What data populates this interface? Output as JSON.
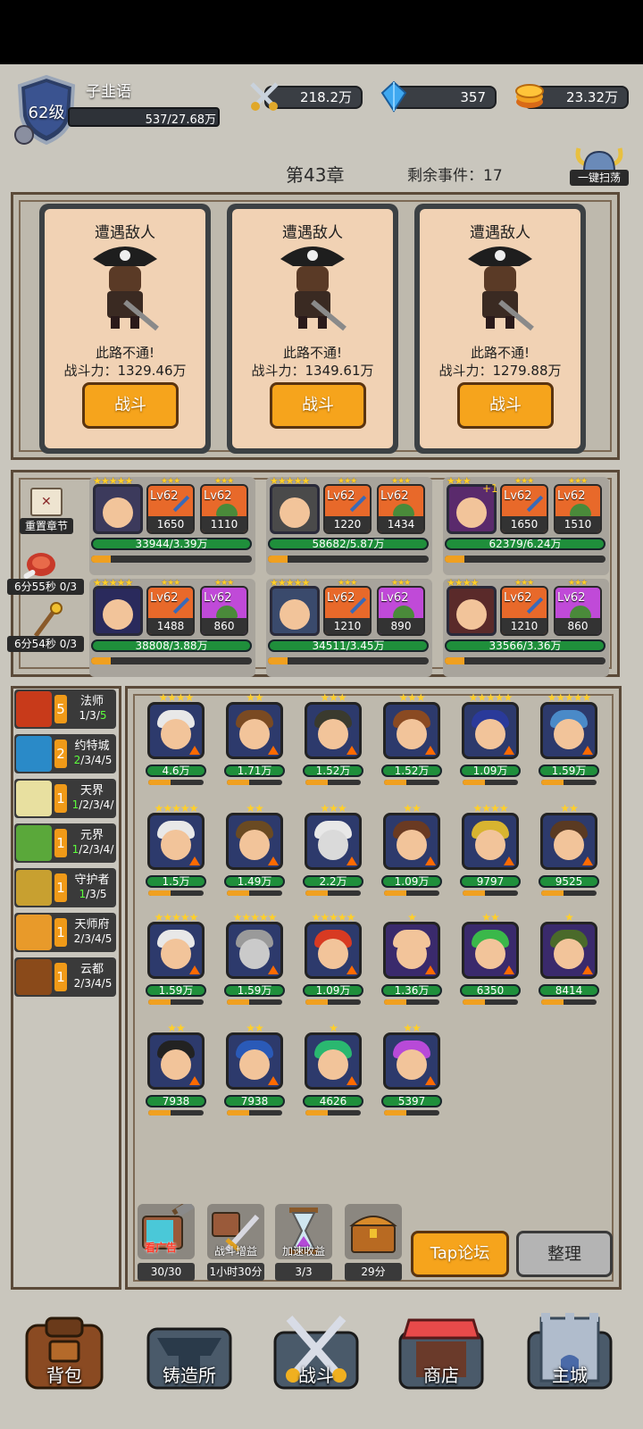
{
  "player": {
    "level": "62级",
    "name": "子韭语",
    "exp": "537/27.68万",
    "exp_fraction": 0.0019
  },
  "resources": {
    "power": "218.2万",
    "gems": "357",
    "gold": "23.32万"
  },
  "chapter": {
    "title": "第43章",
    "remaining_events": "剩余事件：17",
    "sweep_label": "一键扫荡"
  },
  "enemies": [
    {
      "title": "遭遇敌人",
      "desc": "此路不通!",
      "power": "战斗力：1329.46万",
      "button": "战斗"
    },
    {
      "title": "遭遇敌人",
      "desc": "此路不通!",
      "power": "战斗力：1349.61万",
      "button": "战斗"
    },
    {
      "title": "遭遇敌人",
      "desc": "此路不通!",
      "power": "战斗力：1279.88万",
      "button": "战斗"
    }
  ],
  "side_tools": {
    "reset_chapter": "重置章节",
    "timer1": "6分55秒 0/3",
    "timer2": "6分54秒 0/3"
  },
  "team": [
    {
      "stars": "★★★★★",
      "weapon_lv": "Lv62",
      "weapon_val": "1650",
      "armor_lv": "Lv62",
      "armor_val": "1110",
      "hp": "33944/3.39万"
    },
    {
      "stars": "★★★★★",
      "weapon_lv": "Lv62",
      "weapon_val": "1220",
      "armor_lv": "Lv62",
      "armor_val": "1434",
      "hp": "58682/5.87万"
    },
    {
      "stars": "★★★",
      "plus": "+1",
      "weapon_lv": "Lv62",
      "weapon_val": "1650",
      "armor_lv": "Lv62",
      "armor_val": "1510",
      "hp": "62379/6.24万"
    },
    {
      "stars": "★★★★★",
      "weapon_lv": "Lv62",
      "weapon_val": "1488",
      "armor_lv": "Lv62",
      "armor_val": "860",
      "hp": "38808/3.88万"
    },
    {
      "stars": "★★★★★",
      "weapon_lv": "Lv62",
      "weapon_val": "1210",
      "armor_lv": "Lv62",
      "armor_val": "890",
      "hp": "34511/3.45万"
    },
    {
      "stars": "★★★★",
      "weapon_lv": "Lv62",
      "weapon_val": "1210",
      "armor_lv": "Lv62",
      "armor_val": "860",
      "hp": "33566/3.36万"
    }
  ],
  "factions": [
    {
      "count": "5",
      "name": "法师",
      "tiers_a": "1/3/",
      "tiers_b": "5",
      "tiers_c": ""
    },
    {
      "count": "2",
      "name": "约特城",
      "tiers_a": "",
      "tiers_b": "2",
      "tiers_c": "/3/4/5"
    },
    {
      "count": "1",
      "name": "天界",
      "tiers_a": "",
      "tiers_b": "1",
      "tiers_c": "/2/3/4/"
    },
    {
      "count": "1",
      "name": "元界",
      "tiers_a": "",
      "tiers_b": "1",
      "tiers_c": "/2/3/4/"
    },
    {
      "count": "1",
      "name": "守护者",
      "tiers_a": "",
      "tiers_b": "1",
      "tiers_c": "/3/5"
    },
    {
      "count": "1",
      "name": "天师府",
      "tiers_a": "2/3/4/5",
      "tiers_b": "",
      "tiers_c": ""
    },
    {
      "count": "1",
      "name": "云都",
      "tiers_a": "2/3/4/5",
      "tiers_b": "",
      "tiers_c": ""
    }
  ],
  "roster": [
    {
      "stars": "★★★★",
      "power": "4.6万",
      "skin": "#f2c49a",
      "hair": "#e8e8e8",
      "bg": "#2d3a6c"
    },
    {
      "stars": "★★",
      "power": "1.71万",
      "skin": "#f2c49a",
      "hair": "#7a4a22",
      "bg": "#2d3a6c"
    },
    {
      "stars": "★★★",
      "power": "1.52万",
      "skin": "#f2c49a",
      "hair": "#3a3a2e",
      "bg": "#2d3a6c"
    },
    {
      "stars": "★★★",
      "power": "1.52万",
      "skin": "#f2c49a",
      "hair": "#8a4a22",
      "bg": "#2d3a6c"
    },
    {
      "stars": "★★★★★",
      "power": "1.09万",
      "skin": "#f2c49a",
      "hair": "#2a3a9a",
      "bg": "#2d3a6c"
    },
    {
      "stars": "★★★★★",
      "power": "1.59万",
      "skin": "#f2c49a",
      "hair": "#4a8ac8",
      "bg": "#2d3a6c"
    },
    {
      "stars": "★★★★★",
      "power": "1.5万",
      "skin": "#f2c49a",
      "hair": "#e8e8e8",
      "bg": "#2d3a6c"
    },
    {
      "stars": "★★",
      "power": "1.49万",
      "skin": "#f2c49a",
      "hair": "#6a4a22",
      "bg": "#2d3a6c"
    },
    {
      "stars": "★★★",
      "power": "2.2万",
      "skin": "#dadada",
      "hair": "#e8e8e8",
      "bg": "#2d3a6c"
    },
    {
      "stars": "★★",
      "power": "1.09万",
      "skin": "#f2c49a",
      "hair": "#6a3a22",
      "bg": "#2d3a6c"
    },
    {
      "stars": "★★★★",
      "power": "9797",
      "skin": "#f2c49a",
      "hair": "#d8b430",
      "bg": "#2d3a6c"
    },
    {
      "stars": "★★",
      "power": "9525",
      "skin": "#f2c49a",
      "hair": "#5a3a22",
      "bg": "#2d3a6c"
    },
    {
      "stars": "★★★★★",
      "power": "1.59万",
      "skin": "#f2c49a",
      "hair": "#e8e8e8",
      "bg": "#2d3a6c"
    },
    {
      "stars": "★★★★★",
      "power": "1.59万",
      "skin": "#cacaca",
      "hair": "#9a9a9a",
      "bg": "#2d3a6c"
    },
    {
      "stars": "★★★★★",
      "power": "1.09万",
      "skin": "#f2c49a",
      "hair": "#d83a22",
      "bg": "#2d3a6c"
    },
    {
      "stars": "★",
      "power": "1.36万",
      "skin": "#f2c49a",
      "hair": "#f2c49a",
      "bg": "#3a2a6c"
    },
    {
      "stars": "★★",
      "power": "6350",
      "skin": "#f2c49a",
      "hair": "#3ab84a",
      "bg": "#3a2a6c"
    },
    {
      "stars": "★",
      "power": "8414",
      "skin": "#f2c49a",
      "hair": "#4a6a2a",
      "bg": "#3a2a6c"
    },
    {
      "stars": "★★",
      "power": "7938",
      "skin": "#f2c49a",
      "hair": "#222222",
      "bg": "#2d3a6c"
    },
    {
      "stars": "★★",
      "power": "7938",
      "skin": "#f2c49a",
      "hair": "#2a5ab8",
      "bg": "#2d3a6c"
    },
    {
      "stars": "★",
      "power": "4626",
      "skin": "#f2c49a",
      "hair": "#2ab870",
      "bg": "#2d3a6c"
    },
    {
      "stars": "★★",
      "power": "5397",
      "skin": "#f2c49a",
      "hair": "#b84ad8",
      "bg": "#2d3a6c"
    }
  ],
  "utilities": [
    {
      "label": "30/30",
      "overlay": "看广告"
    },
    {
      "label": "1小时30分",
      "overlay": "战斗增益"
    },
    {
      "label": "3/3",
      "overlay": "加速收益"
    },
    {
      "label": "29分",
      "overlay": ""
    }
  ],
  "buttons": {
    "forum": "Tap论坛",
    "organize": "整理"
  },
  "nav": {
    "bag": "背包",
    "forge": "铸造所",
    "battle": "战斗",
    "shop": "商店",
    "city": "主城"
  },
  "colors": {
    "accent_orange": "#f6a41c",
    "hp_green": "#1f8f3b",
    "card_bg": "#f1d2b4",
    "purple_equip": "#c04ad8",
    "orange_equip": "#e8692a"
  }
}
